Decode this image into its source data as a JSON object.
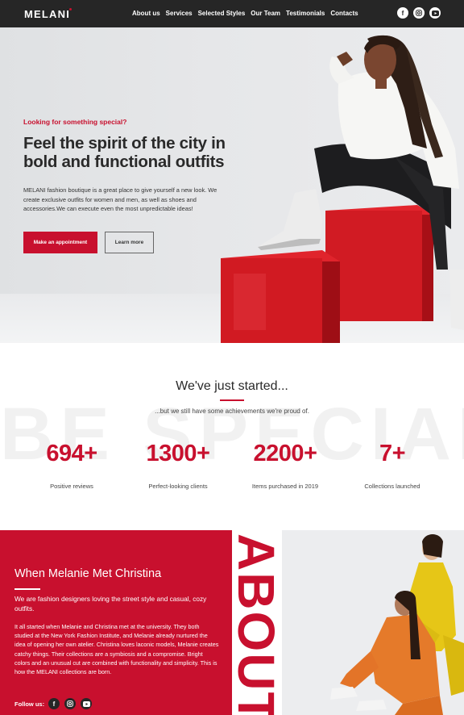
{
  "brand": {
    "logo": "MELANI"
  },
  "nav": [
    "About us",
    "Services",
    "Selected Styles",
    "Our Team",
    "Testimonials",
    "Contacts"
  ],
  "social": [
    "facebook-icon",
    "instagram-icon",
    "youtube-icon"
  ],
  "colors": {
    "accent": "#c8102e",
    "dark": "#262626"
  },
  "hero": {
    "kicker": "Looking for something special?",
    "title": "Feel the spirit of the city in bold and functional outfits",
    "text": "MELANI fashion boutique is a great place to give yourself a new look. We create exclusive outfits for women and men, as well as shoes and accessories.We can execute even the most unpredictable ideas!",
    "primary_button": "Make an appointment",
    "secondary_button": "Learn more"
  },
  "stats": {
    "title": "We've just started...",
    "subtitle": "...but we still have some achievements we're proud of.",
    "background_word": "BE SPECIAL",
    "items": [
      {
        "value": "694+",
        "label": "Positive reviews"
      },
      {
        "value": "1300+",
        "label": "Perfect-looking clients"
      },
      {
        "value": "2200+",
        "label": "Items purchased in 2019"
      },
      {
        "value": "7+",
        "label": "Collections launched"
      }
    ]
  },
  "about": {
    "title": "When Melanie Met Christina",
    "lead": "We are fashion designers loving the street style and casual, cozy outfits.",
    "body": "It all started when Melanie and Christina met at the university. They both studied at the New York Fashion Institute, and Melanie already nurtured the idea of opening her own atelier. Christina loves laconic models, Melanie creates catchy things. Their collections are a symbiosis and a compromise. Bright colors and an unusual cut are combined with functionality and simplicity. This is how the MELANI collections are born.",
    "vertical_word": "ABOUT",
    "follow_label": "Follow us:"
  }
}
